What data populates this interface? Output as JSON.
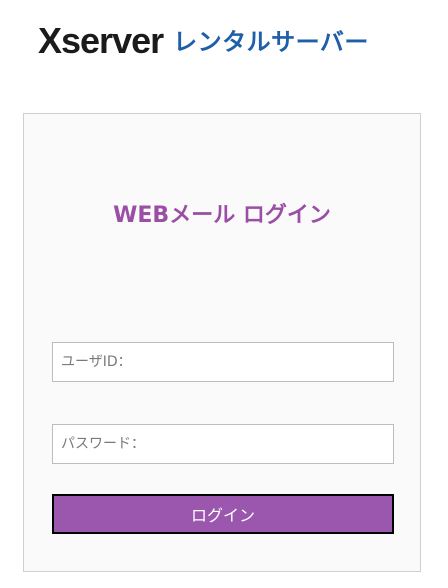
{
  "brand": {
    "logo_text": "Xserver",
    "product_text": "レンタルサーバー",
    "colors": {
      "logo": "#1b1b1b",
      "product": "#1f5ea8"
    }
  },
  "login": {
    "title": "WEBメール ログイン",
    "username": {
      "value": "",
      "placeholder": "ユーザID："
    },
    "password": {
      "value": "",
      "placeholder": "パスワード："
    },
    "submit_label": "ログイン",
    "colors": {
      "title": "#9b4ea6",
      "button": "#9b57ad",
      "box_background": "#fafafa"
    }
  }
}
